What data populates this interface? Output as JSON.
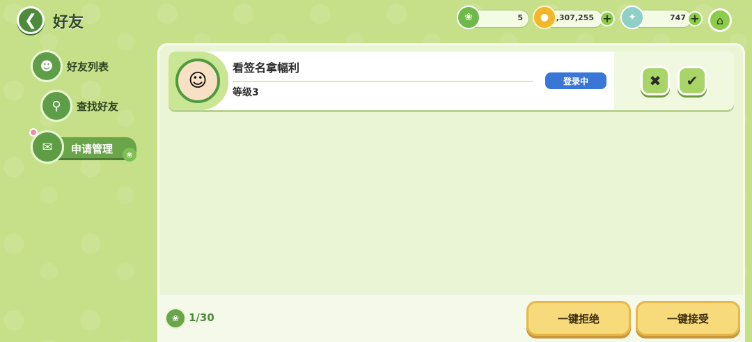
{
  "header": {
    "title": "好友",
    "back_icon": "chevron-left-icon",
    "resources": [
      {
        "name": "leaf",
        "icon": "leaf-icon",
        "value": "5"
      },
      {
        "name": "coin",
        "icon": "coin-icon",
        "value": "1,307,255"
      },
      {
        "name": "crystal",
        "icon": "crystal-icon",
        "value": "747"
      }
    ],
    "home_icon": "home-icon"
  },
  "sidebar": {
    "items": [
      {
        "label": "好友列表",
        "icon": "friends-icon",
        "active": false
      },
      {
        "label": "查找好友",
        "icon": "search-icon",
        "active": false
      },
      {
        "label": "申请管理",
        "icon": "request-icon",
        "active": true
      }
    ]
  },
  "requests": [
    {
      "name": "看签名拿幅利",
      "level": "等级3",
      "status": "登录中",
      "reject_icon": "close-icon",
      "accept_icon": "check-icon"
    }
  ],
  "footer": {
    "count": "1/30",
    "reject_all": "一键拒绝",
    "accept_all": "一键接受"
  },
  "colors": {
    "background": "#c6e08a",
    "accent_green": "#4e8a3b",
    "status_blue": "#3a76d6",
    "button_yellow": "#f7da7a"
  }
}
